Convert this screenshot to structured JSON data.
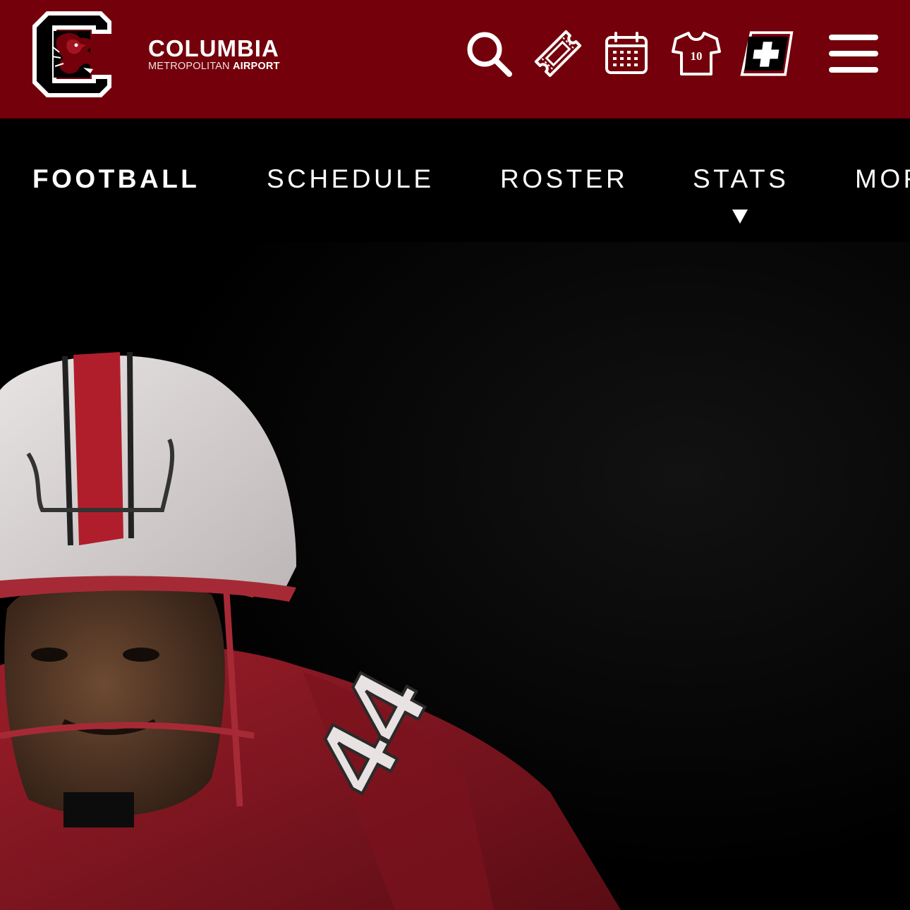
{
  "header": {
    "sponsor_name": "COLUMBIA",
    "sponsor_sub_light": "METROPOLITAN",
    "sponsor_sub_bold": "AIRPORT",
    "jersey_number": "10",
    "icons": [
      "gamecock-c-logo",
      "search-icon",
      "ticket-icon",
      "calendar-icon",
      "jersey-icon",
      "sec-network-plus-icon",
      "menu-icon"
    ]
  },
  "subnav": {
    "items": [
      {
        "label": "FOOTBALL",
        "active": true
      },
      {
        "label": "SCHEDULE",
        "active": false
      },
      {
        "label": "ROSTER",
        "active": false
      },
      {
        "label": "STATS",
        "active": false,
        "has_dropdown": true
      },
      {
        "label": "MORE",
        "active": false
      }
    ]
  },
  "hero": {
    "jersey_number": "44"
  },
  "colors": {
    "garnet": "#73000a",
    "black": "#000000",
    "white": "#ffffff",
    "jersey_red": "#8c1a24"
  }
}
